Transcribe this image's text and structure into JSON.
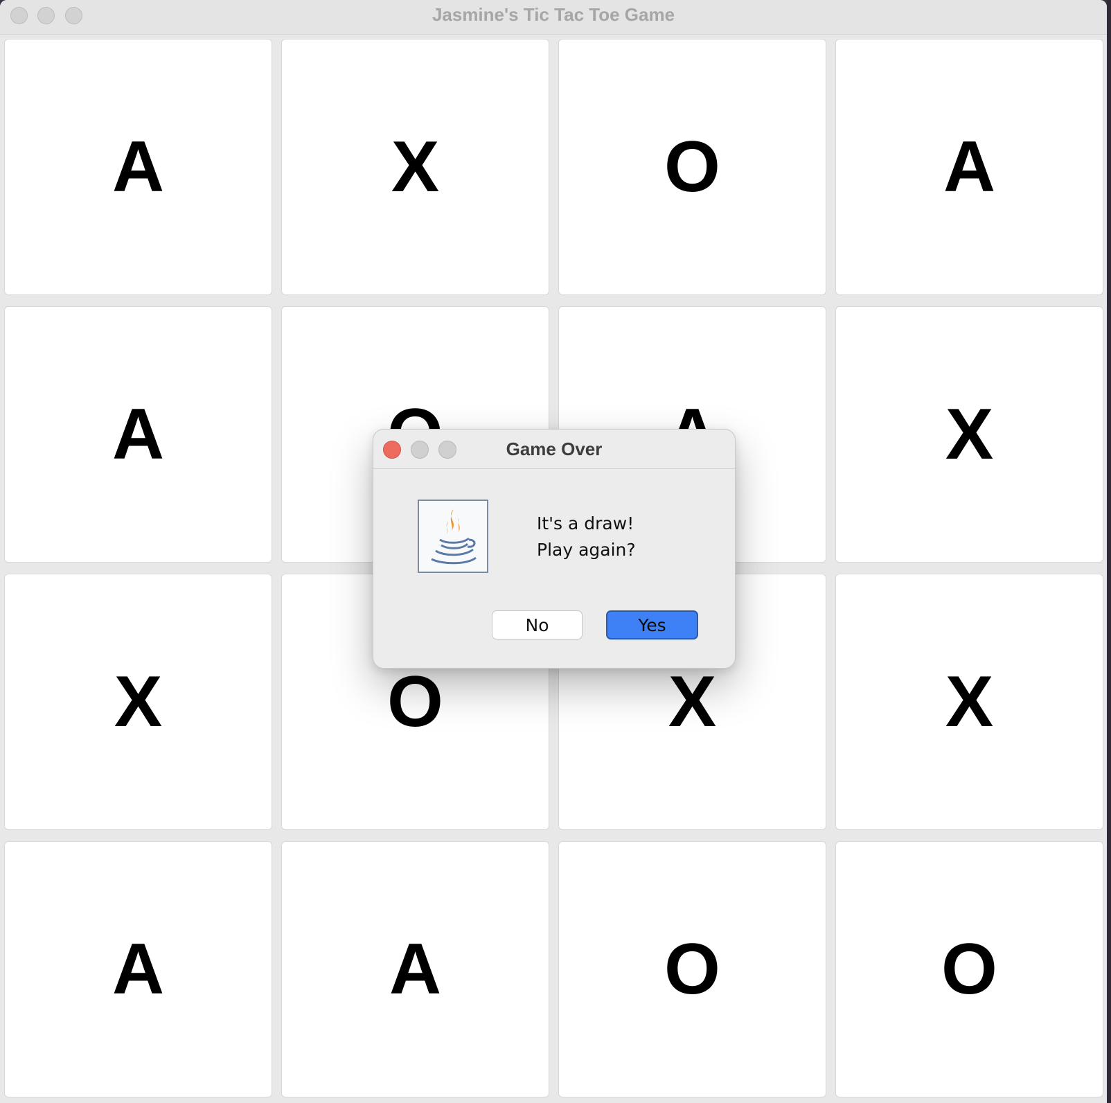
{
  "window": {
    "title": "Jasmine's Tic Tac Toe Game"
  },
  "board": {
    "cells": [
      [
        "A",
        "X",
        "O",
        "A"
      ],
      [
        "A",
        "O",
        "A",
        "X"
      ],
      [
        "X",
        "O",
        "X",
        "X"
      ],
      [
        "A",
        "A",
        "O",
        "O"
      ]
    ]
  },
  "dialog": {
    "title": "Game Over",
    "message_line1": "It's a draw!",
    "message_line2": "Play again?",
    "icon": "java-icon",
    "buttons": {
      "no": "No",
      "yes": "Yes"
    }
  },
  "colors": {
    "yes_button": "#3e80f6",
    "close_dot": "#ec6a5e"
  }
}
